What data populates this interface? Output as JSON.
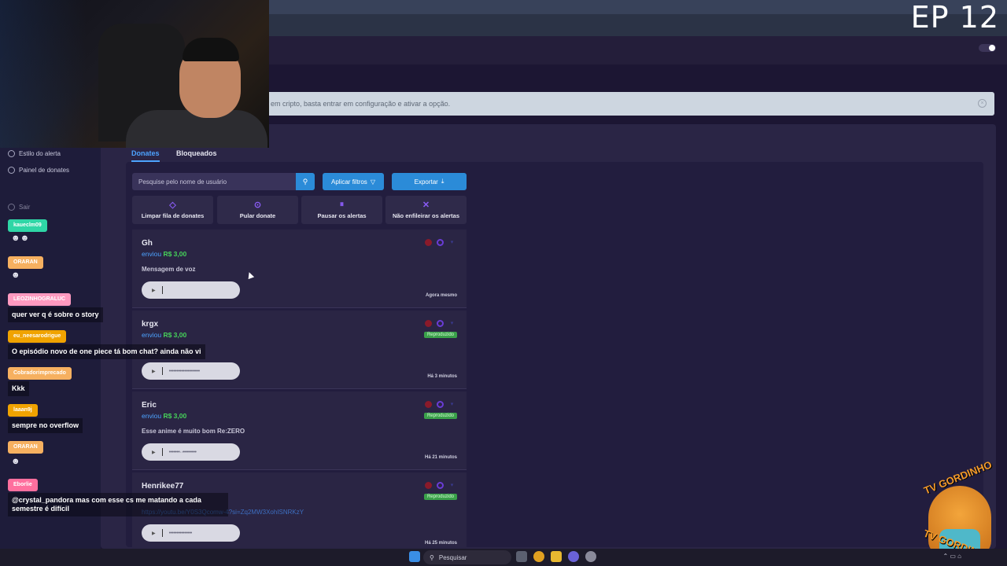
{
  "overlay": {
    "episode": "EP 12"
  },
  "banner": {
    "text": "em cripto, basta entrar em configuração e ativar a opção."
  },
  "sidebar": {
    "items": [
      {
        "label": "Estilo do alerta",
        "icon": "palette-icon"
      },
      {
        "label": "Painel de donates",
        "icon": "hand-coin-icon"
      },
      {
        "label": "Sair",
        "icon": "logout-icon"
      }
    ]
  },
  "tabs": [
    {
      "label": "Donates",
      "active": true
    },
    {
      "label": "Bloqueados",
      "active": false
    }
  ],
  "search": {
    "placeholder": "Pesquise pelo nome de usuário"
  },
  "toolbar": {
    "filters_label": "Aplicar filtros",
    "export_label": "Exportar"
  },
  "actions": [
    {
      "label": "Limpar fila de donates",
      "icon": "eraser-icon"
    },
    {
      "label": "Pular donate",
      "icon": "skip-icon"
    },
    {
      "label": "Pausar os alertas",
      "icon": "pause-icon"
    },
    {
      "label": "Não enfileirar os alertas",
      "icon": "bell-off-icon"
    }
  ],
  "donations": [
    {
      "name": "Gh",
      "sent_prefix": "enviou",
      "amount": "R$ 3,00",
      "message": "Mensagem de voz",
      "link": "",
      "time": "Agora mesmo",
      "badge": ""
    },
    {
      "name": "krgx",
      "sent_prefix": "enviou",
      "amount": "R$ 3,00",
      "message": "",
      "link": "",
      "time": "Há 3 minutos",
      "badge": "Reproduzido"
    },
    {
      "name": "Eric",
      "sent_prefix": "enviou",
      "amount": "R$ 3,00",
      "message": "Esse anime é muito bom Re:ZERO",
      "link": "",
      "time": "Há 21 minutos",
      "badge": "Reproduzido"
    },
    {
      "name": "Henrikee77",
      "sent_prefix": "",
      "amount": "",
      "message": "",
      "link": "https://youtu.be/Y0S3Qcomw-4?si=Zq2MW3XohISNRKzY",
      "time": "Há 25 minutos",
      "badge": "Reproduzido"
    }
  ],
  "chat": [
    {
      "user": "kaueclm09",
      "color": "#2fd6a6",
      "message": ""
    },
    {
      "user": "ORARAN",
      "color": "#f6b060",
      "message": ""
    },
    {
      "user": "LEOZINHOGRALUC",
      "color": "#ff9ac0",
      "message": "quer ver q é sobre o story"
    },
    {
      "user": "eu_neesarodrigue",
      "color": "#f0a300",
      "message": "O episódio novo de one piece tá bom chat? ainda não vi"
    },
    {
      "user": "Cobradorimprecado",
      "color": "#f6b060",
      "message": "Kkk"
    },
    {
      "user": "laaan9j",
      "color": "#f0a300",
      "message": "sempre no overflow"
    },
    {
      "user": "ORARAN",
      "color": "#f6b060",
      "message": ""
    },
    {
      "user": "Eborlie",
      "color": "#ff6f9e",
      "message": "@crystal_pandora mas com esse cs me matando a cada semestre é difícil"
    }
  ],
  "watermark": {
    "top": "TV GORDINHO",
    "bottom": "TV GORDINHO"
  },
  "taskbar": {
    "search_placeholder": "Pesquisar"
  }
}
